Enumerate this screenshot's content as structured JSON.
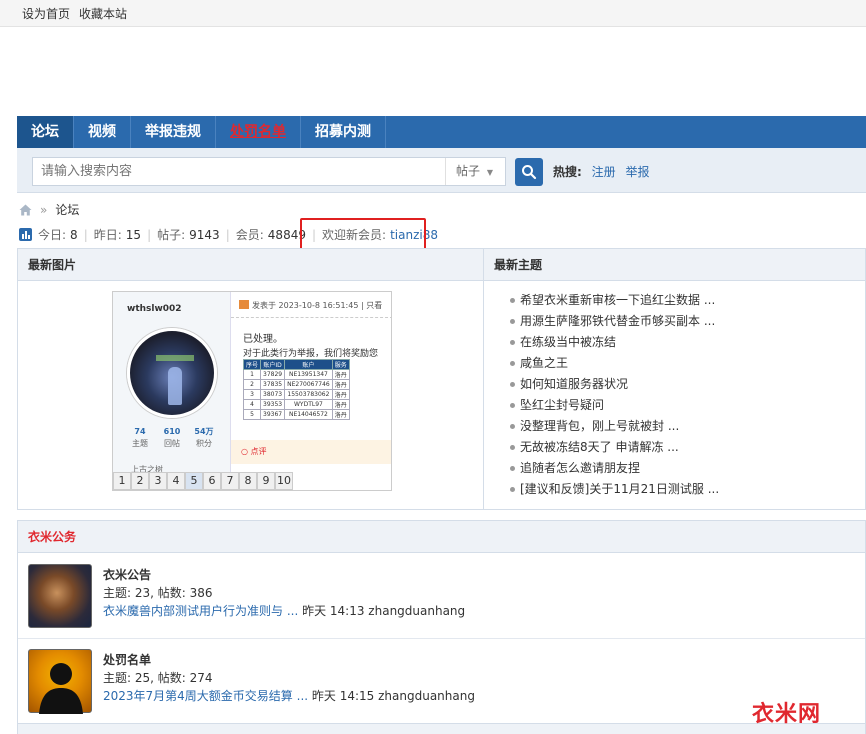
{
  "topbar": {
    "set_home": "设为首页",
    "bookmark": "收藏本站"
  },
  "nav": {
    "items": [
      {
        "label": "论坛"
      },
      {
        "label": "视频"
      },
      {
        "label": "举报违规"
      },
      {
        "label": "处罚名单"
      },
      {
        "label": "招募内测"
      }
    ]
  },
  "search": {
    "placeholder": "请输入搜索内容",
    "type_label": "帖子",
    "hot_label": "热搜:",
    "hot_links": [
      "注册",
      "举报"
    ]
  },
  "breadcrumb": {
    "current": "论坛"
  },
  "stats": {
    "today_label": "今日:",
    "today": "8",
    "yesterday_label": "昨日:",
    "yesterday": "15",
    "posts_label": "帖子:",
    "posts": "9143",
    "members_label": "会员:",
    "members": "48849",
    "welcome_label": "欢迎新会员:",
    "new_member": "tianzi88"
  },
  "latest_images": {
    "title": "最新图片",
    "preview": {
      "username": "wthslw002",
      "post_header": "发表于 2023-10-8 16:51:45 | 只看",
      "processed": "已处理。",
      "notice": "对于此类行为举报，我们将奖励您",
      "table_headers": [
        "序号",
        "账户ID",
        "账户",
        "服务"
      ],
      "table_rows": [
        [
          "1",
          "37829",
          "NE13951347",
          "洛丹"
        ],
        [
          "2",
          "37835",
          "NE270067746",
          "洛丹"
        ],
        [
          "3",
          "38073",
          "15503783062",
          "洛丹"
        ],
        [
          "4",
          "39353",
          "WYDTL97",
          "洛丹"
        ],
        [
          "5",
          "39367",
          "NE14046572",
          "洛丹"
        ]
      ],
      "user_stats": [
        {
          "value": "74",
          "label": "主题"
        },
        {
          "value": "610",
          "label": "回帖"
        },
        {
          "value": "54万",
          "label": "积分"
        }
      ],
      "rank": "上古之树",
      "comment": "点评"
    },
    "pages": [
      "1",
      "2",
      "3",
      "4",
      "5",
      "6",
      "7",
      "8",
      "9",
      "10"
    ]
  },
  "latest_topics": {
    "title": "最新主题",
    "items": [
      "希望衣米重新审核一下追红尘数据 ...",
      "用源生萨隆邪铁代替金币够买副本 ...",
      "在练级当中被冻结",
      "咸鱼之王",
      "如何知道服务器状况",
      "坠红尘封号疑问",
      "没整理背包，刚上号就被封 ...",
      "无故被冻结8天了 申请解冻 ...",
      "追随者怎么邀请朋友捏",
      "[建议和反馈]关于11月21日测试服 ..."
    ]
  },
  "board": {
    "title": "衣米公务",
    "forums": [
      {
        "name": "衣米公告",
        "meta": "主题: 23, 帖数: 386",
        "last_post": "衣米魔兽内部测试用户行为准则与 ...",
        "last_info": "昨天 14:13 zhangduanhang"
      },
      {
        "name": "处罚名单",
        "meta": "主题: 25, 帖数: 274",
        "last_post": "2023年7月第4周大额金币交易结算 ...",
        "last_info": "昨天 14:15 zhangduanhang"
      }
    ]
  },
  "watermark": "衣米网",
  "colors": {
    "nav": "#2b6aad",
    "accent_red": "#e0282f",
    "link": "#2b6aad"
  }
}
